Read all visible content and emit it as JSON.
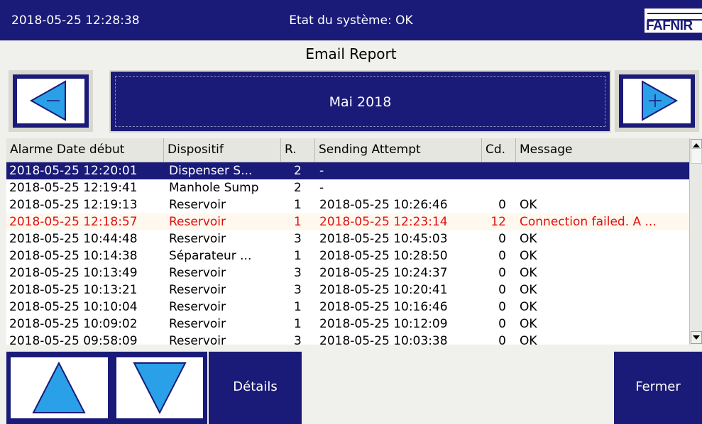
{
  "header": {
    "datetime": "2018-05-25  12:28:38",
    "system_status": "Etat du système: OK",
    "logo_text": "FAFNIR"
  },
  "title": "Email Report",
  "month_nav": {
    "month": "Mai  2018",
    "prev_icon": "arrow-left-icon",
    "next_icon": "arrow-right-icon"
  },
  "table": {
    "columns": [
      "Alarme Date début",
      "Dispositif",
      "R.",
      "Sending Attempt",
      "Cd.",
      "Message"
    ],
    "rows": [
      {
        "date": "2018-05-25 12:20:01",
        "device": "Dispenser S...",
        "r": "2",
        "sent": "-",
        "cd": "",
        "msg": "",
        "state": "selected"
      },
      {
        "date": "2018-05-25 12:19:41",
        "device": "Manhole Sump",
        "r": "2",
        "sent": "-",
        "cd": "",
        "msg": "",
        "state": "normal"
      },
      {
        "date": "2018-05-25 12:19:13",
        "device": "Reservoir",
        "r": "1",
        "sent": "2018-05-25 10:26:46",
        "cd": "0",
        "msg": "OK",
        "state": "normal"
      },
      {
        "date": "2018-05-25 12:18:57",
        "device": "Reservoir",
        "r": "1",
        "sent": "2018-05-25 12:23:14",
        "cd": "12",
        "msg": "Connection failed. A ...",
        "state": "error"
      },
      {
        "date": "2018-05-25 10:44:48",
        "device": "Reservoir",
        "r": "3",
        "sent": "2018-05-25 10:45:03",
        "cd": "0",
        "msg": "OK",
        "state": "normal"
      },
      {
        "date": "2018-05-25 10:14:38",
        "device": "Séparateur ...",
        "r": "1",
        "sent": "2018-05-25 10:28:50",
        "cd": "0",
        "msg": "OK",
        "state": "normal"
      },
      {
        "date": "2018-05-25 10:13:49",
        "device": "Reservoir",
        "r": "3",
        "sent": "2018-05-25 10:24:37",
        "cd": "0",
        "msg": "OK",
        "state": "normal"
      },
      {
        "date": "2018-05-25 10:13:21",
        "device": "Reservoir",
        "r": "3",
        "sent": "2018-05-25 10:20:41",
        "cd": "0",
        "msg": "OK",
        "state": "normal"
      },
      {
        "date": "2018-05-25 10:10:04",
        "device": "Reservoir",
        "r": "1",
        "sent": "2018-05-25 10:16:46",
        "cd": "0",
        "msg": "OK",
        "state": "normal"
      },
      {
        "date": "2018-05-25 10:09:02",
        "device": "Reservoir",
        "r": "1",
        "sent": "2018-05-25 10:12:09",
        "cd": "0",
        "msg": "OK",
        "state": "normal"
      },
      {
        "date": "2018-05-25 09:58:09",
        "device": "Reservoir",
        "r": "3",
        "sent": "2018-05-25 10:03:38",
        "cd": "0",
        "msg": "OK",
        "state": "normal"
      }
    ]
  },
  "buttons": {
    "up_icon": "arrow-up-icon",
    "down_icon": "arrow-down-icon",
    "details": "Détails",
    "close": "Fermer"
  },
  "colors": {
    "panel": "#1a1a78",
    "arrow": "#2aa0e8",
    "error_text": "#e01010"
  }
}
